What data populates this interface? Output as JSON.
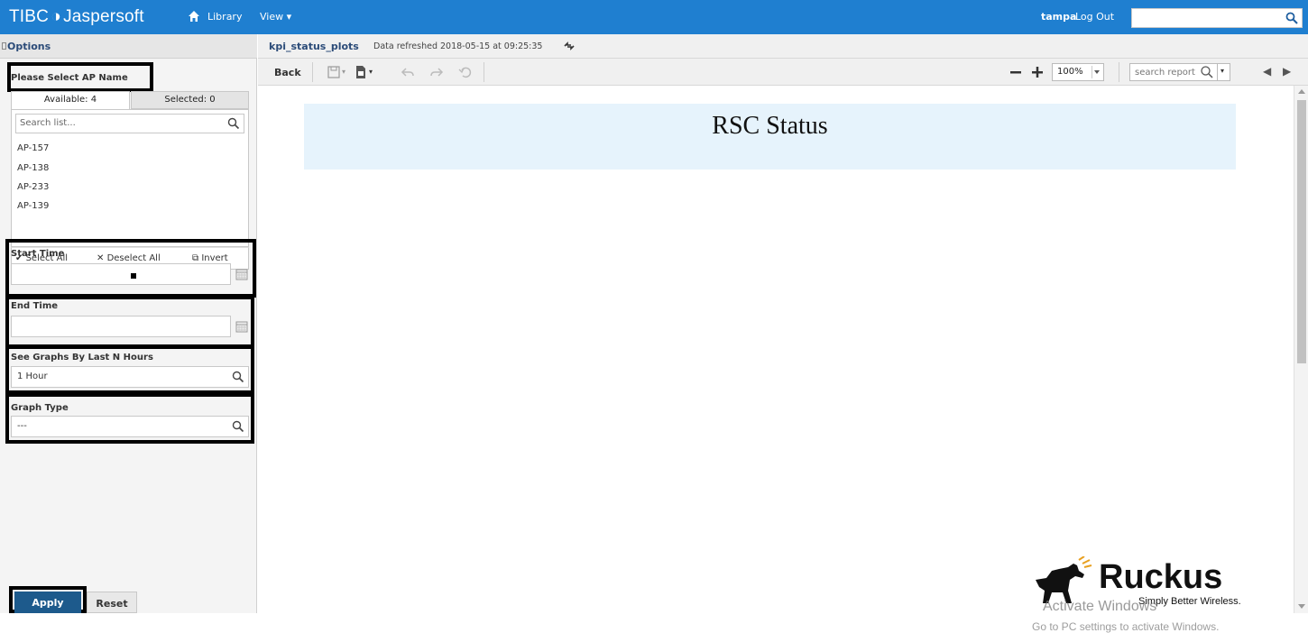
{
  "app": {
    "logo_brand": "TIBC",
    "logo_product": "Jaspersoft",
    "nav_library": "Library",
    "nav_view": "View ▾",
    "username": "tampa",
    "logout": "Log Out",
    "search_value": ""
  },
  "options": {
    "header": "Options",
    "ap_section_label": "Please Select AP Name",
    "tab_available": "Available: 4",
    "tab_selected": "Selected: 0",
    "search_placeholder": "Search list...",
    "ap_items": [
      "AP-157",
      "AP-138",
      "AP-233",
      "AP-139"
    ],
    "select_all": "Select All",
    "deselect_all": "Deselect All",
    "invert": "Invert",
    "start_time_label": "Start Time",
    "start_time_value": "",
    "end_time_label": "End Time",
    "end_time_value": "",
    "last_n_hours_label": "See Graphs By Last N Hours",
    "last_n_hours_value": "1 Hour",
    "graph_type_label": "Graph Type",
    "graph_type_value": "---",
    "apply": "Apply",
    "reset": "Reset"
  },
  "report": {
    "name": "kpi_status_plots",
    "refreshed": "Data refreshed 2018-05-15 at 09:25:35",
    "back": "Back",
    "zoom": "100%",
    "search_placeholder": "search report",
    "title": "RSC Status"
  },
  "branding": {
    "ruckus_word": "Ruckus",
    "ruckus_tagline": "Simply Better Wireless.",
    "watermark_title": "Activate Windows",
    "watermark_sub": "Go to PC settings to activate Windows."
  },
  "colors": {
    "topbar": "#1f7fd0",
    "apply_button": "#1d5a8c",
    "report_banner": "#e6f3fc",
    "label_blue": "#2b4b78"
  }
}
